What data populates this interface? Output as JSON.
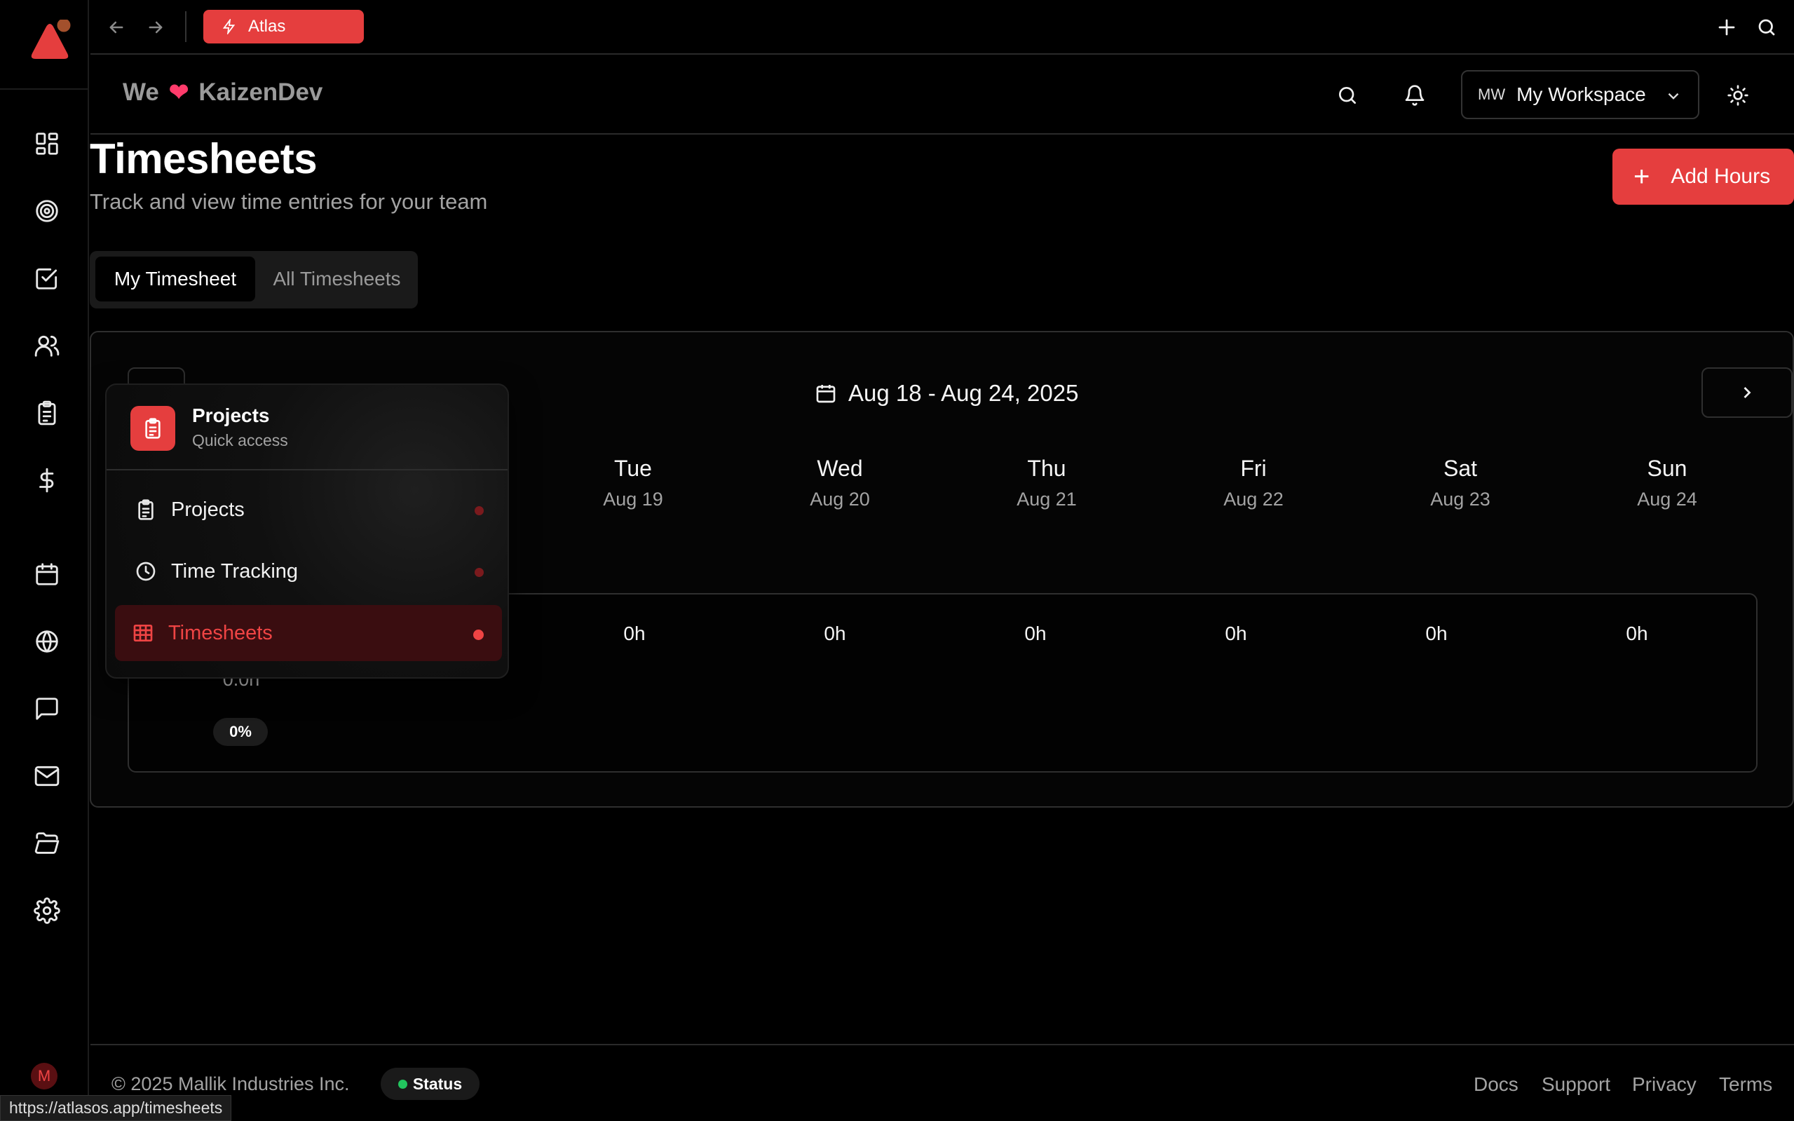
{
  "topbar": {
    "app_tab_label": "Atlas"
  },
  "header": {
    "brand_prefix": "We",
    "brand_heart": "❤",
    "brand_name": "KaizenDev",
    "workspace_initials": "MW",
    "workspace_name": "My Workspace"
  },
  "page": {
    "title": "Timesheets",
    "subtitle": "Track and view time entries for your team",
    "add_button_plus": "+",
    "add_button_label": "Add Hours"
  },
  "tabs": [
    {
      "label": "My Timesheet",
      "active": true
    },
    {
      "label": "All Timesheets",
      "active": false
    }
  ],
  "week": {
    "range": "Aug 18 - Aug 24, 2025",
    "days": [
      {
        "name": "Tue",
        "date": "Aug 19",
        "hours": "0h"
      },
      {
        "name": "Wed",
        "date": "Aug 20",
        "hours": "0h"
      },
      {
        "name": "Thu",
        "date": "Aug 21",
        "hours": "0h"
      },
      {
        "name": "Fri",
        "date": "Aug 22",
        "hours": "0h"
      },
      {
        "name": "Sat",
        "date": "Aug 23",
        "hours": "0h"
      },
      {
        "name": "Sun",
        "date": "Aug 24",
        "hours": "0h"
      }
    ],
    "total": "0.0h",
    "percent": "0%"
  },
  "popover": {
    "title": "Projects",
    "subtitle": "Quick access",
    "items": [
      {
        "label": "Projects",
        "icon": "clipboard-icon",
        "active": false
      },
      {
        "label": "Time Tracking",
        "icon": "clock-icon",
        "active": false
      },
      {
        "label": "Timesheets",
        "icon": "table-icon",
        "active": true
      }
    ]
  },
  "footer": {
    "copyright": "© 2025 Mallik Industries Inc.",
    "status_label": "Status",
    "links": [
      "Docs",
      "Support",
      "Privacy",
      "Terms"
    ]
  },
  "sidebar": {
    "user_initial": "M",
    "icons": [
      "dashboard-icon",
      "target-icon",
      "tasks-icon",
      "users-icon",
      "clipboard-icon",
      "dollar-icon",
      "calendar-icon",
      "globe-icon",
      "chat-icon",
      "mail-icon",
      "folder-icon",
      "settings-icon"
    ]
  },
  "status_bar_url": "https://atlasos.app/timesheets",
  "colors": {
    "accent": "#e53e3e",
    "background": "#000000",
    "status_green": "#22c55e"
  }
}
